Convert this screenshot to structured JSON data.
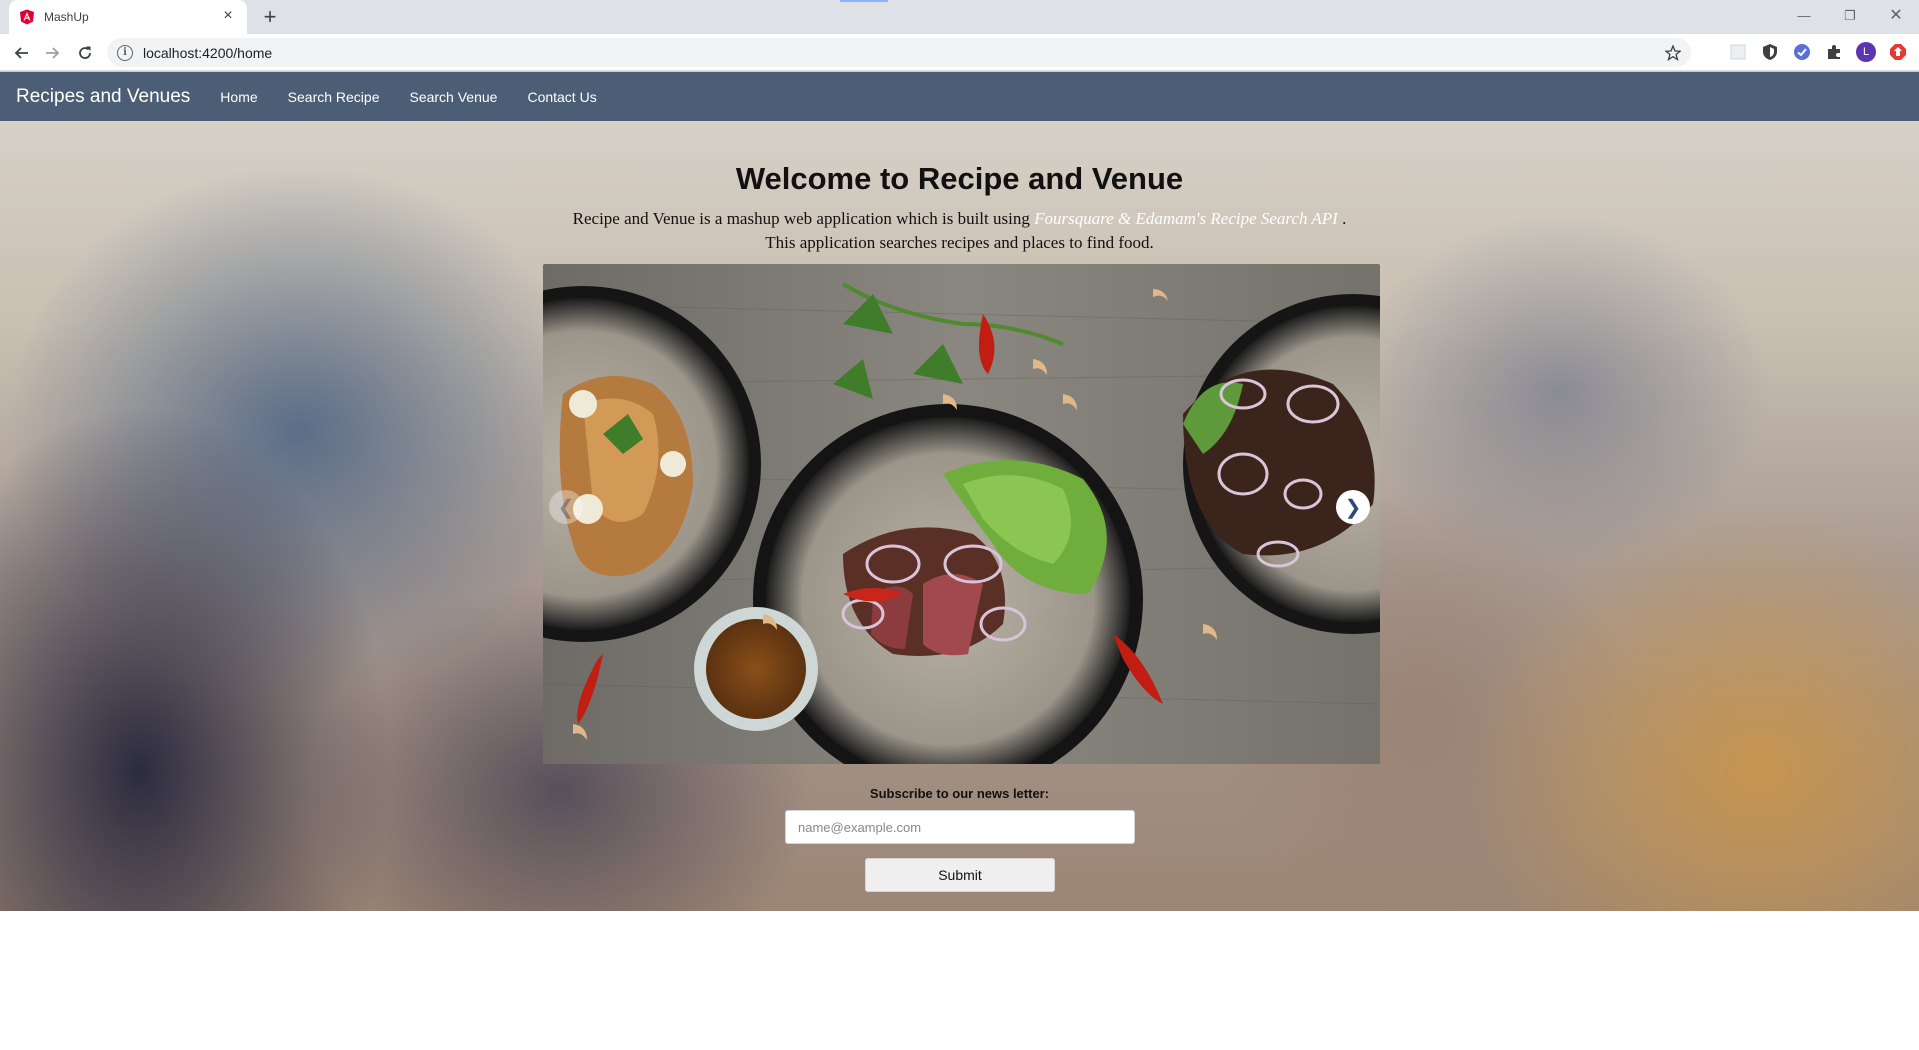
{
  "browser": {
    "tab_title": "MashUp",
    "url": "localhost:4200/home",
    "profile_initial": "L"
  },
  "navbar": {
    "brand": "Recipes and Venues",
    "links": [
      "Home",
      "Search Recipe",
      "Search Venue",
      "Contact Us"
    ]
  },
  "hero": {
    "welcome_prefix": "Welcome to",
    "welcome_bold": "Recipe and Venue",
    "desc_part1": "Recipe and Venue is a mashup web application which is built using",
    "desc_api": "Foursquare & Edamam's Recipe Search API",
    "desc_part2": ".",
    "desc_line2": "This application searches recipes and places to find food."
  },
  "carousel": {
    "prev_symbol": "❮",
    "next_symbol": "❯"
  },
  "subscribe": {
    "label": "Subscribe to our news letter:",
    "placeholder": "name@example.com",
    "value": "",
    "submit_label": "Submit"
  },
  "colors": {
    "navbar_bg": "#4b5e75",
    "tab_favicon": "#dd0031",
    "profile_avatar": "#5e35b1"
  }
}
